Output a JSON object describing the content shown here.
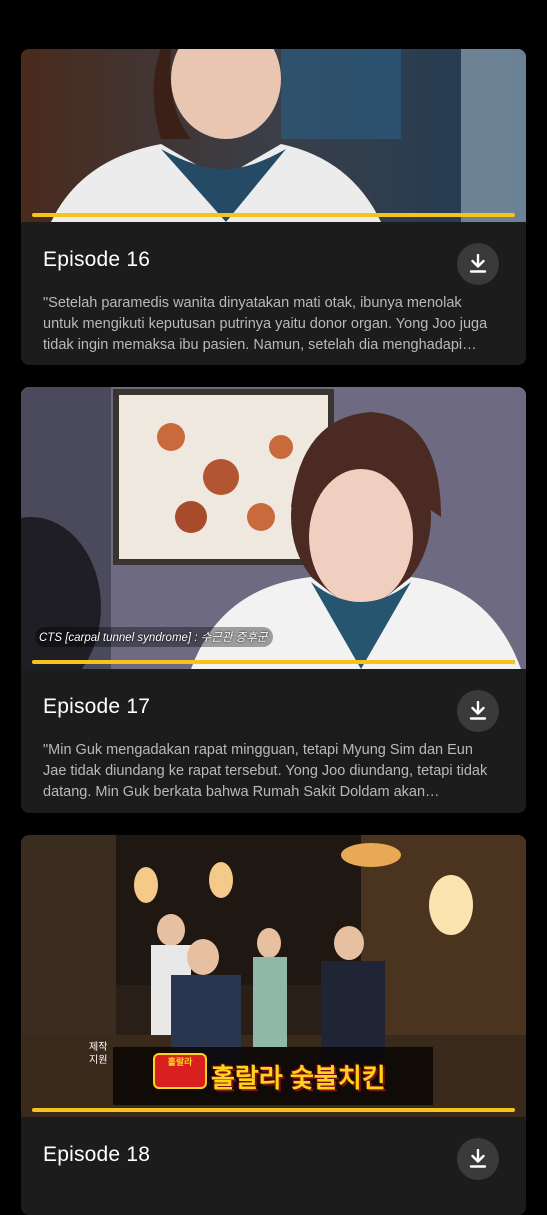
{
  "episodes": [
    {
      "title": "Episode 16",
      "description": "\"Setelah paramedis wanita dinyatakan mati otak, ibunya menolak untuk mengikuti keputusan putrinya yaitu donor organ. Yong Joo juga tidak ingin memaksa ibu pasien. Namun, setelah dia menghadapi kenyataan...",
      "progress": 1.0
    },
    {
      "title": "Episode 17",
      "description": "\"Min Guk mengadakan rapat mingguan, tetapi Myung Sim dan Eun Jae tidak diundang ke rapat tersebut. Yong Joo diundang, tetapi tidak datang. Min Guk berkata bahwa Rumah Sakit Doldam akan menghadapi...",
      "progress": 1.0,
      "caption": "CTS [carpal tunnel syndrome] : 수근관 증후군"
    },
    {
      "title": "Episode 18",
      "progress": 1.0,
      "sponsor_label": "제작\n지원",
      "sponsor_name": "홀랄라 숯불치킨",
      "sponsor_logo_text": "홀랄라"
    }
  ],
  "colors": {
    "accent": "#f6c21c",
    "card_bg": "#1c1c1c",
    "page_bg": "#000000"
  },
  "icons": {
    "download": "download-icon"
  }
}
